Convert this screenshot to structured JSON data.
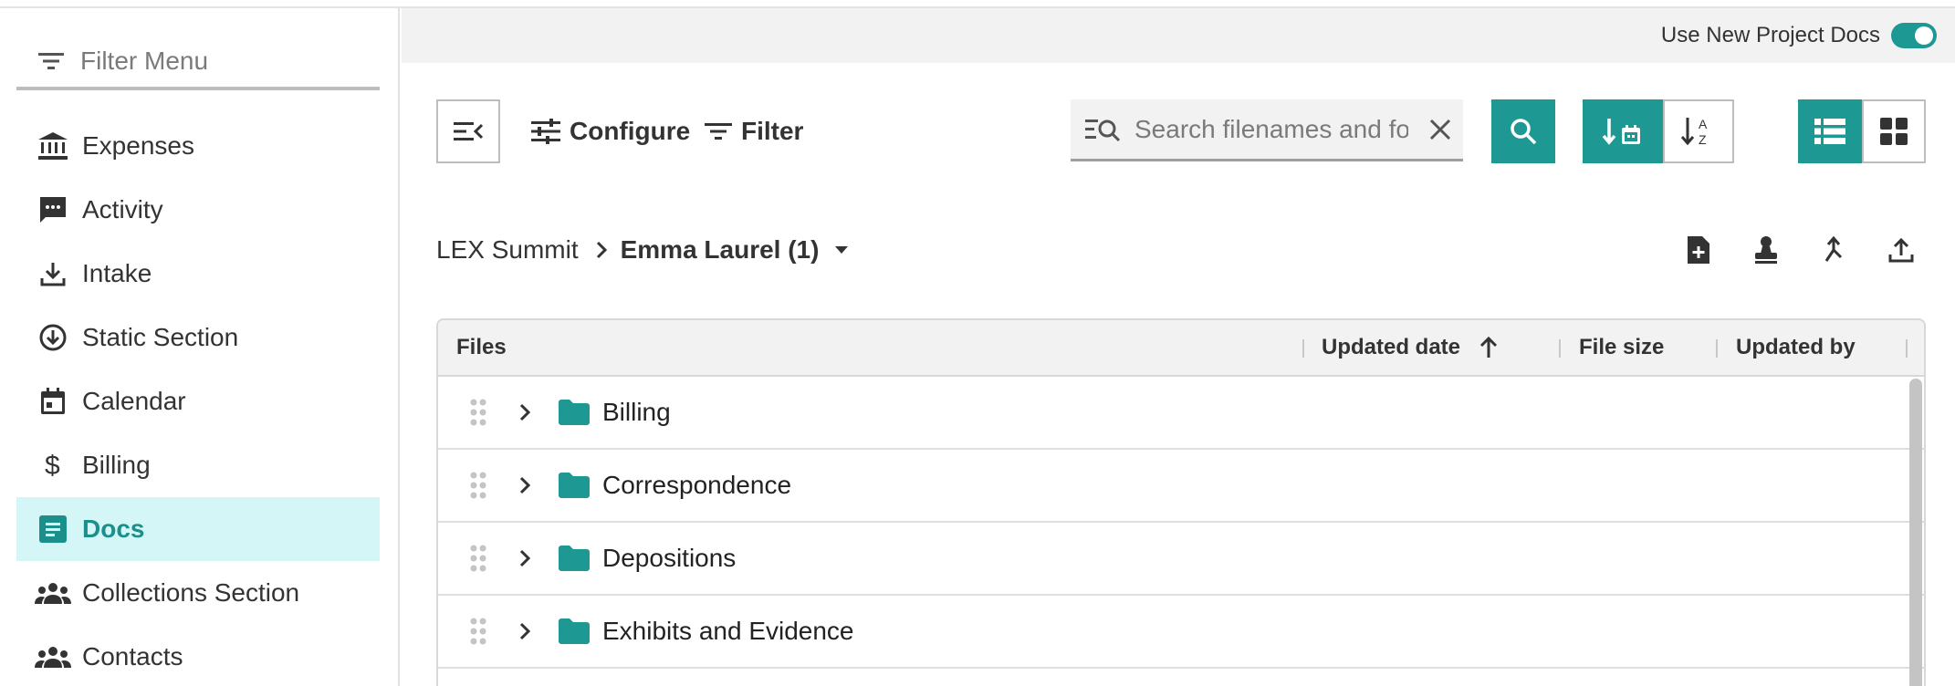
{
  "sidebar": {
    "filter_placeholder": "Filter Menu",
    "items": [
      {
        "label": "Expenses",
        "icon": "bank-icon"
      },
      {
        "label": "Activity",
        "icon": "chat-icon"
      },
      {
        "label": "Intake",
        "icon": "download-icon"
      },
      {
        "label": "Static Section",
        "icon": "arrow-circle-down-icon"
      },
      {
        "label": "Calendar",
        "icon": "calendar-icon"
      },
      {
        "label": "Billing",
        "icon": "dollar-icon"
      },
      {
        "label": "Docs",
        "icon": "document-icon",
        "active": true
      },
      {
        "label": "Collections Section",
        "icon": "group-icon"
      },
      {
        "label": "Contacts",
        "icon": "group-icon"
      }
    ]
  },
  "project_bar": {
    "label": "Use New Project Docs",
    "toggle_on": true
  },
  "toolbar": {
    "configure_label": "Configure",
    "filter_label": "Filter",
    "search_placeholder": "Search filenames and folders"
  },
  "breadcrumb": {
    "root": "LEX Summit",
    "current": "Emma Laurel (1)"
  },
  "table": {
    "columns": {
      "files": "Files",
      "updated_date": "Updated date",
      "file_size": "File size",
      "updated_by": "Updated by"
    },
    "rows": [
      {
        "name": "Billing"
      },
      {
        "name": "Correspondence"
      },
      {
        "name": "Depositions"
      },
      {
        "name": "Exhibits and Evidence"
      }
    ]
  },
  "colors": {
    "accent": "#1e9893",
    "active_bg": "#d5f6f7",
    "active_text": "#1a8f8c"
  }
}
